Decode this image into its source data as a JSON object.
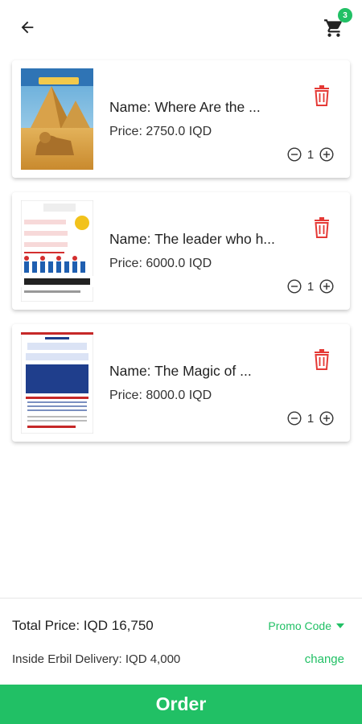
{
  "header": {
    "back_icon": "arrow-left-icon",
    "cart_icon": "shopping-cart-icon",
    "cart_count": "3"
  },
  "items": [
    {
      "name": "Name: Where Are the ...",
      "price": "Price: 2750.0 IQD",
      "quantity": "1",
      "cover_title": "Where Are the Great Pyramids?"
    },
    {
      "name": "Name: The leader who h...",
      "price": "Price: 6000.0 IQD",
      "quantity": "1",
      "cover_title": "THE LEADER WHO HAD NO TITLE",
      "cover_author": "ROBIN SHARMA"
    },
    {
      "name": "Name: The Magic of ...",
      "price": "Price: 8000.0 IQD",
      "quantity": "1",
      "cover_title": "THE MAGIC OF THINKING BIG"
    }
  ],
  "summary": {
    "total": "Total Price: IQD 16,750",
    "promo_label": "Promo Code",
    "delivery": "Inside Erbil Delivery: IQD 4,000",
    "change_label": "change"
  },
  "order_label": "Order",
  "colors": {
    "accent": "#21c065",
    "delete": "#e53935"
  }
}
